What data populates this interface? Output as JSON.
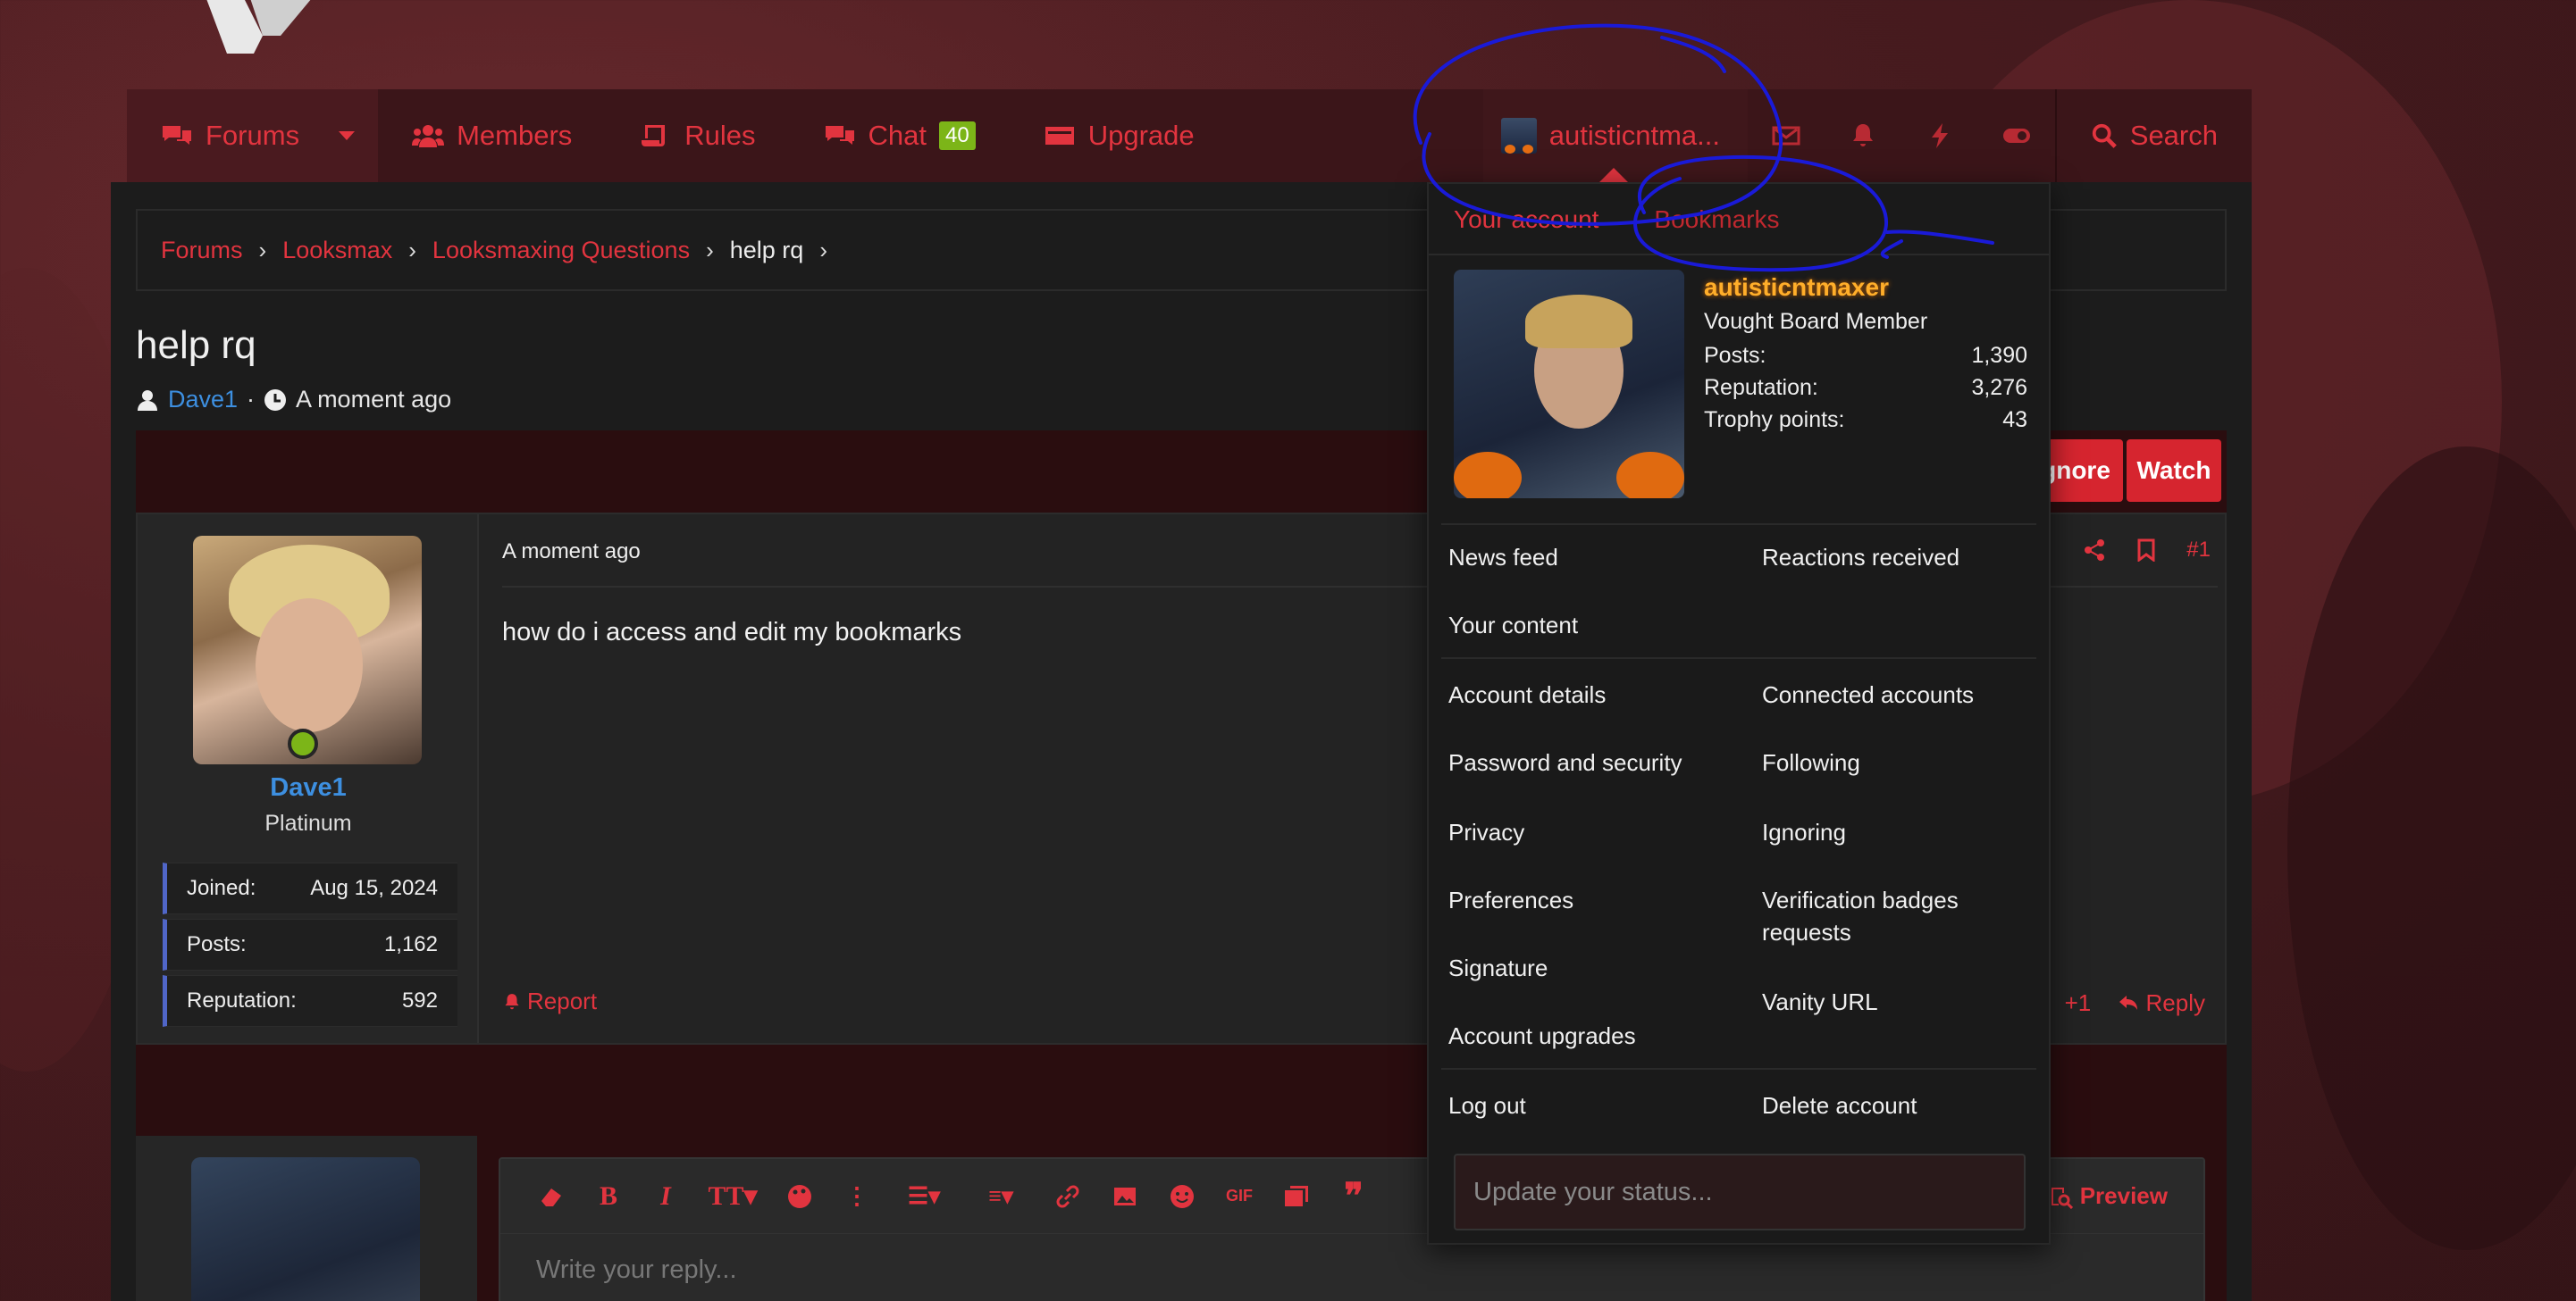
{
  "nav": {
    "forums": "Forums",
    "members": "Members",
    "rules": "Rules",
    "chat": "Chat",
    "chat_count": "40",
    "upgrade": "Upgrade",
    "user": "autisticntma...",
    "search": "Search"
  },
  "breadcrumb": [
    "Forums",
    "Looksmax",
    "Looksmaxing Questions",
    "help rq"
  ],
  "thread": {
    "title": "help rq",
    "author": "Dave1",
    "time": "A moment ago",
    "ignore_label": "gnore",
    "watch_label": "Watch"
  },
  "post": {
    "username": "Dave1",
    "rank": "Platinum",
    "stats": [
      {
        "label": "Joined:",
        "value": "Aug 15, 2024"
      },
      {
        "label": "Posts:",
        "value": "1,162"
      },
      {
        "label": "Reputation:",
        "value": "592"
      }
    ],
    "time": "A moment ago",
    "text": "how do i access and edit my bookmarks",
    "number": "#1",
    "report": "Report",
    "like": "+1",
    "reply": "Reply"
  },
  "editor": {
    "placeholder": "Write your reply...",
    "preview": "Preview",
    "gif": "GIF"
  },
  "menu": {
    "tab_account": "Your account",
    "tab_bookmarks": "Bookmarks",
    "username": "autisticntmaxer",
    "title": "Vought Board Member",
    "stats": [
      {
        "label": "Posts:",
        "value": "1,390"
      },
      {
        "label": "Reputation:",
        "value": "3,276"
      },
      {
        "label": "Trophy points:",
        "value": "43"
      }
    ],
    "items": {
      "news_feed": "News feed",
      "reactions": "Reactions received",
      "your_content": "Your content",
      "account_details": "Account details",
      "connected": "Connected accounts",
      "password": "Password and security",
      "following": "Following",
      "privacy": "Privacy",
      "ignoring": "Ignoring",
      "preferences": "Preferences",
      "verification": "Verification badges requests",
      "signature": "Signature",
      "vanity": "Vanity URL",
      "upgrades": "Account upgrades",
      "logout": "Log out",
      "delete": "Delete account"
    },
    "status_placeholder": "Update your status..."
  },
  "colors": {
    "accent": "#e2343f",
    "link_blue": "#3d8fe0",
    "online": "#7cb518",
    "username_gold": "#ffae2a",
    "annotation_blue": "#1a1ad8"
  }
}
